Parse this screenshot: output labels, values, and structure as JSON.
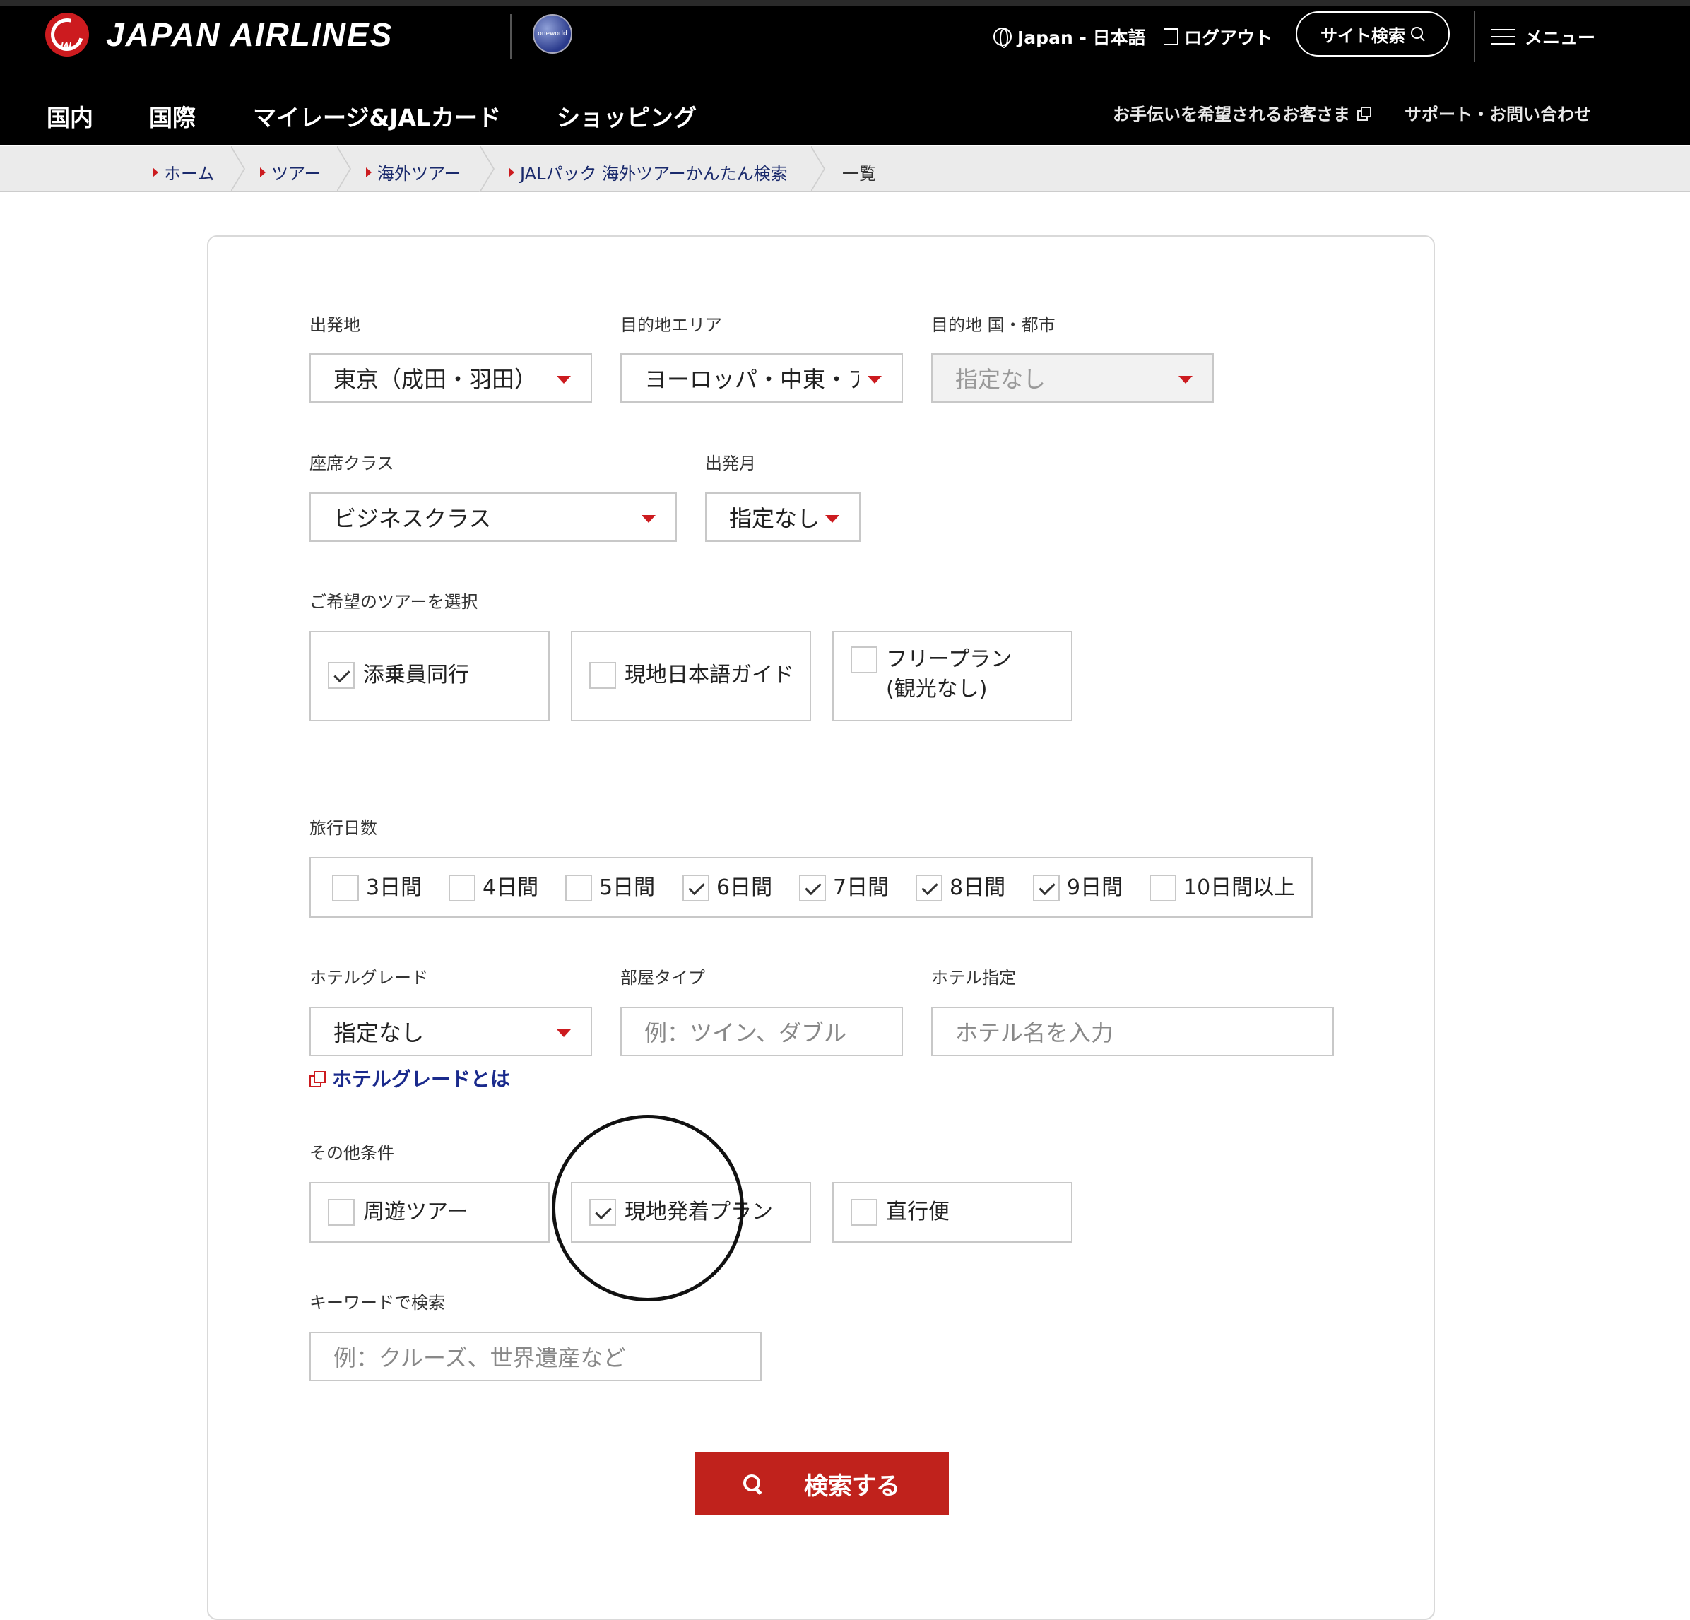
{
  "header": {
    "brand": "JAPAN AIRLINES",
    "brand_mark_text": "JAL",
    "alliance_text": "oneworld",
    "language": "Japan - 日本語",
    "logout": "ログアウト",
    "site_search": "サイト検索",
    "menu": "メニュー"
  },
  "nav": {
    "items": [
      "国内",
      "国際",
      "マイレージ&JALカード",
      "ショッピング"
    ],
    "assist": "お手伝いを希望されるお客さま",
    "support": "サポート・お問い合わせ"
  },
  "breadcrumb": {
    "items": [
      "ホーム",
      "ツアー",
      "海外ツアー",
      "JALパック 海外ツアーかんたん検索"
    ],
    "current": "一覧"
  },
  "form": {
    "departure": {
      "label": "出発地",
      "value": "東京（成田・羽田）"
    },
    "destination_area": {
      "label": "目的地エリア",
      "value": "ヨーロッパ・中東・ア"
    },
    "destination_city": {
      "label": "目的地 国・都市",
      "value": "指定なし"
    },
    "seat_class": {
      "label": "座席クラス",
      "value": "ビジネスクラス"
    },
    "departure_month": {
      "label": "出発月",
      "value": "指定なし"
    },
    "tour_type": {
      "label": "ご希望のツアーを選択",
      "options": [
        {
          "label": "添乗員同行",
          "checked": true
        },
        {
          "label": "現地日本語ガイド",
          "checked": false
        },
        {
          "label": "フリープラン",
          "label2": "(観光なし)",
          "checked": false
        }
      ]
    },
    "days": {
      "label": "旅行日数",
      "options": [
        {
          "label": "3日間",
          "checked": false
        },
        {
          "label": "4日間",
          "checked": false
        },
        {
          "label": "5日間",
          "checked": false
        },
        {
          "label": "6日間",
          "checked": true
        },
        {
          "label": "7日間",
          "checked": true
        },
        {
          "label": "8日間",
          "checked": true
        },
        {
          "label": "9日間",
          "checked": true
        },
        {
          "label": "10日間以上",
          "checked": false
        }
      ]
    },
    "hotel_grade": {
      "label": "ホテルグレード",
      "value": "指定なし",
      "link": "ホテルグレードとは"
    },
    "room_type": {
      "label": "部屋タイプ",
      "placeholder": "例：ツイン、ダブル"
    },
    "hotel": {
      "label": "ホテル指定",
      "placeholder": "ホテル名を入力"
    },
    "other": {
      "label": "その他条件",
      "options": [
        {
          "label": "周遊ツアー",
          "checked": false
        },
        {
          "label": "現地発着プラン",
          "checked": true
        },
        {
          "label": "直行便",
          "checked": false
        }
      ]
    },
    "keyword": {
      "label": "キーワードで検索",
      "placeholder": "例：クルーズ、世界遺産など"
    },
    "search_button": "検索する"
  },
  "colors": {
    "accent_red": "#cc1b1f",
    "button_red": "#c0221c",
    "link_navy": "#1a2a8c",
    "header_bg": "#000000"
  },
  "icons": [
    "jal-crane-logo",
    "oneworld-logo",
    "globe-icon",
    "logout-icon",
    "search-icon",
    "menu-icon",
    "new-window-icon",
    "caret-down-icon",
    "checkbox-icon",
    "external-link-icon"
  ]
}
